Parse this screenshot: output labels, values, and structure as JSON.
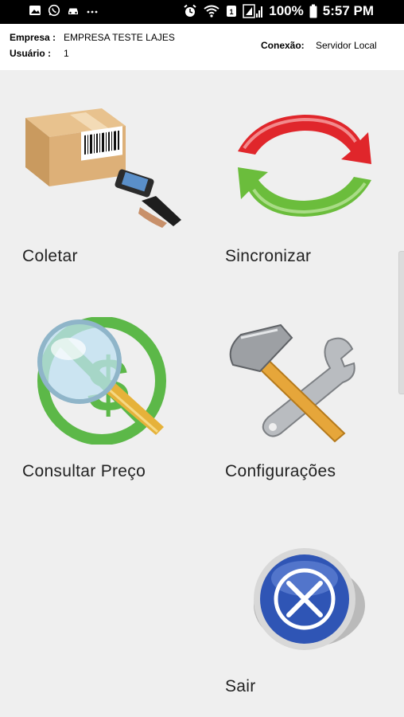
{
  "status_bar": {
    "battery": "100%",
    "time": "5:57 PM",
    "left_icons": [
      "image-icon",
      "whatsapp-icon",
      "car-icon",
      "more-icon"
    ],
    "right_icons": [
      "alarm-icon",
      "wifi-icon",
      "data-icon",
      "signal-icon",
      "battery-icon"
    ]
  },
  "header": {
    "empresa_label": "Empresa :",
    "empresa_value": "EMPRESA TESTE LAJES",
    "usuario_label": "Usuário :",
    "usuario_value": "1",
    "conexao_label": "Conexão:",
    "conexao_value": "Servidor Local"
  },
  "menu": {
    "coletar": {
      "label": "Coletar",
      "icon": "barcode-scanner-box-icon"
    },
    "sincronizar": {
      "label": "Sincronizar",
      "icon": "sync-arrows-icon"
    },
    "consultar": {
      "label": "Consultar Preço",
      "icon": "price-search-icon"
    },
    "configuracoes": {
      "label": "Configurações",
      "icon": "tools-icon"
    },
    "sair": {
      "label": "Sair",
      "icon": "close-circle-icon"
    }
  },
  "colors": {
    "background": "#efefef",
    "header_bg": "#ffffff",
    "status_bar_bg": "#000000",
    "sync_red": "#e0262b",
    "sync_green": "#6bbd3c",
    "price_green": "#5cb848",
    "exit_blue": "#2f55b5"
  }
}
